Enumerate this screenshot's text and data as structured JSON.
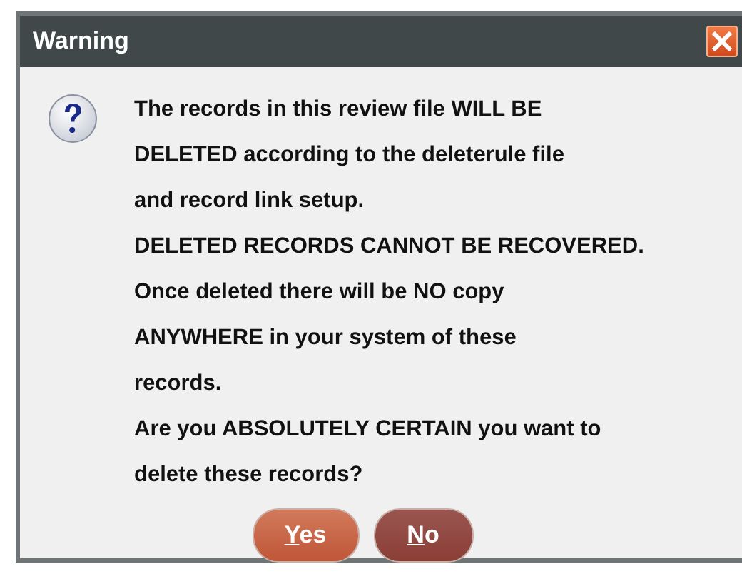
{
  "window": {
    "title": "Warning"
  },
  "message": {
    "lines": [
      "The records in this review file WILL BE",
      "DELETED according to the deleterule file",
      "and record link setup.",
      "DELETED RECORDS CANNOT BE RECOVERED.",
      "Once deleted there will be NO copy",
      "ANYWHERE in your system of these",
      "records.",
      "Are you ABSOLUTELY CERTAIN you want to",
      "delete these records?"
    ]
  },
  "buttons": [
    {
      "mnemonic": "Y",
      "rest": "es",
      "default": true
    },
    {
      "mnemonic": "N",
      "rest": "o",
      "default": false
    }
  ]
}
